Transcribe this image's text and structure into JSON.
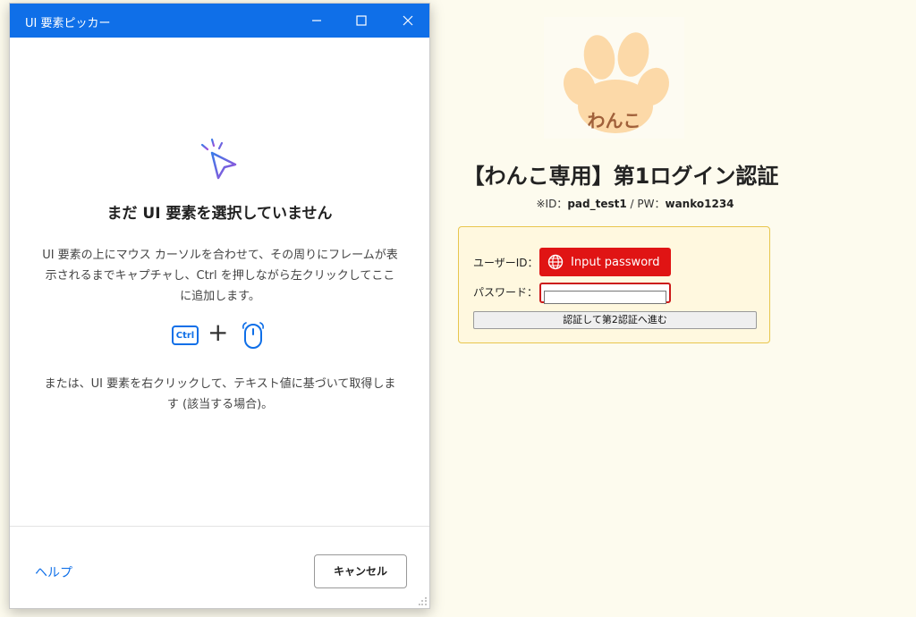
{
  "web_page": {
    "logo_text": "わんこ",
    "title": "【わんこ専用】第1ログイン認証",
    "credentials": {
      "id_prefix": "※ID：",
      "id_value": "pad_test1",
      "pw_prefix": " / PW：",
      "pw_value": "wanko1234"
    },
    "form": {
      "user_label": "ユーザーID：",
      "input_badge_label": "Input password",
      "password_label": "パスワード：",
      "password_value": "",
      "submit_label": "認証して第2認証へ進む"
    }
  },
  "picker": {
    "title": "UI 要素ピッカー",
    "heading": "まだ UI 要素を選択していません",
    "description": "UI 要素の上にマウス カーソルを合わせて、その周りにフレームが表示されるまでキャプチャし、Ctrl を押しながら左クリックしてここに追加します。",
    "ctrl_key": "Ctrl",
    "plus": "+",
    "description2": "または、UI 要素を右クリックして、テキスト値に基づいて取得します (該当する場合)。",
    "help_link": "ヘルプ",
    "cancel_label": "キャンセル"
  },
  "colors": {
    "titlebar": "#0f6fe8",
    "accent": "#0f6fe8",
    "badge_red": "#e01414",
    "page_bg": "#fdfbee"
  },
  "icons": [
    "minimize-icon",
    "maximize-icon",
    "close-icon",
    "cursor-sparkle-icon",
    "mouse-icon",
    "globe-icon",
    "paw-icon",
    "resize-grip-icon"
  ]
}
